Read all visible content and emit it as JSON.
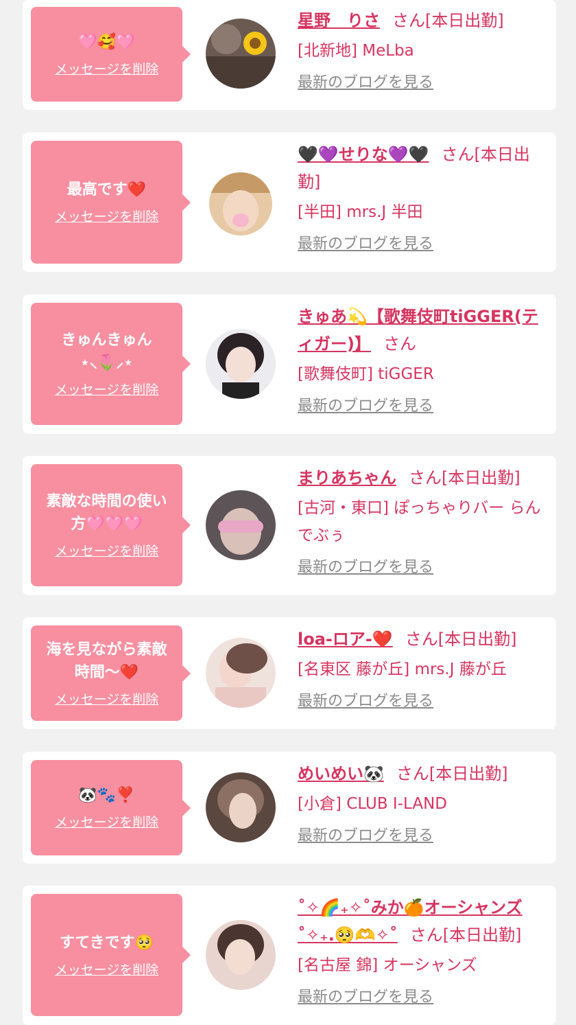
{
  "cards": [
    {
      "message": "🩷🥰🩷",
      "delete_label": "メッセージを削除",
      "name": "星野　りさ",
      "suffix": "さん[本日出勤]",
      "shop": "[北新地] MeLba",
      "blog_label": "最新のブログを見る"
    },
    {
      "message": "最高です❤️",
      "delete_label": "メッセージを削除",
      "name": "🖤💜せりな💜🖤",
      "suffix": "さん[本日出勤]",
      "shop": "[半田] mrs.J 半田",
      "blog_label": "最新のブログを見る"
    },
    {
      "message": "きゅんきゅん ⋆⸜🌷⸝⋆",
      "delete_label": "メッセージを削除",
      "name": "きゅあ💫【歌舞伎町tiGGER(ティガー)】",
      "suffix": "さん",
      "shop": "[歌舞伎町] tiGGER",
      "blog_label": "最新のブログを見る"
    },
    {
      "message": "素敵な時間の使い方🩷🩷🩷",
      "delete_label": "メッセージを削除",
      "name": "まりあちゃん",
      "suffix": "さん[本日出勤]",
      "shop": "[古河・東口] ぽっちゃりバー らんでぶぅ",
      "blog_label": "最新のブログを見る"
    },
    {
      "message": "海を見ながら素敵時間〜❤️",
      "delete_label": "メッセージを削除",
      "name": "loa-ロア-❤️",
      "suffix": "さん[本日出勤]",
      "shop": "[名東区 藤が丘] mrs.J 藤が丘",
      "blog_label": "最新のブログを見る"
    },
    {
      "message": "🐼🐾❣️",
      "delete_label": "メッセージを削除",
      "name": "めいめい🐼",
      "suffix": "さん[本日出勤]",
      "shop": "[小倉] CLUB I-LAND",
      "blog_label": "最新のブログを見る"
    },
    {
      "message": "すてきです🥺",
      "delete_label": "メッセージを削除",
      "name": "˚✧🌈₊✧˚みか🍊オーシャンズ˚✧₊.🥺🫶✧˚",
      "suffix": "さん[本日出勤]",
      "shop": "[名古屋 錦] オーシャンズ",
      "blog_label": "最新のブログを見る"
    }
  ]
}
